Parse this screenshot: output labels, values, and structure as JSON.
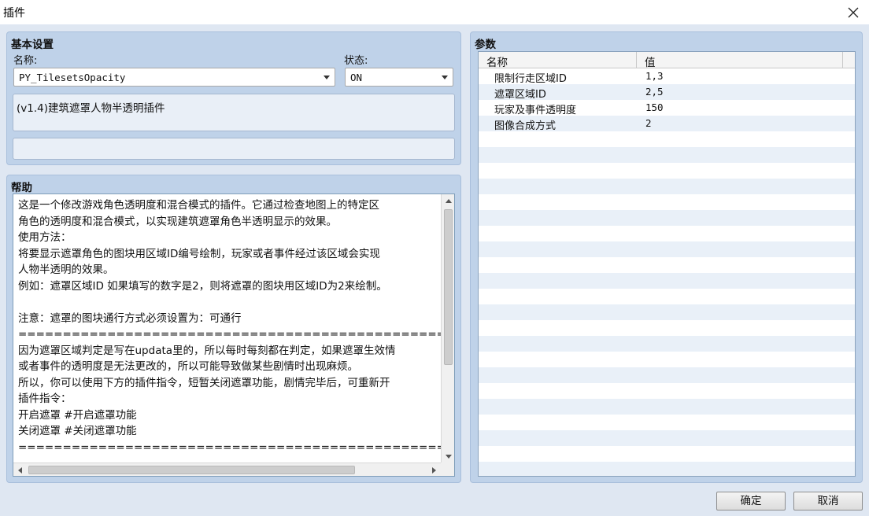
{
  "window": {
    "title": "插件"
  },
  "basic": {
    "title": "基本设置",
    "name_label": "名称:",
    "name_value": "PY_TilesetsOpacity",
    "status_label": "状态:",
    "status_value": "ON",
    "description": "(v1.4)建筑遮罩人物半透明插件",
    "author": ""
  },
  "help": {
    "title": "帮助",
    "lines": [
      "这是一个修改游戏角色透明度和混合模式的插件。它通过检查地图上的特定区",
      "角色的透明度和混合模式，以实现建筑遮罩角色半透明显示的效果。",
      "使用方法：",
      "将要显示遮罩角色的图块用区域ID编号绘制，玩家或者事件经过该区域会实现",
      "人物半透明的效果。",
      "例如：遮罩区域ID 如果填写的数字是2，则将遮罩的图块用区域ID为2来绘制。",
      "",
      "注意：遮罩的图块通行方式必须设置为：可通行",
      "==========================================================================",
      "因为遮罩区域判定是写在updata里的，所以每时每刻都在判定，如果遮罩生效情",
      "或者事件的透明度是无法更改的，所以可能导致做某些剧情时出现麻烦。",
      "所以，你可以使用下方的插件指令，短暂关闭遮罩功能，剧情完毕后，可重新开",
      "插件指令：",
      "开启遮罩  #开启遮罩功能",
      "关闭遮罩  #关闭遮罩功能",
      "=========================================================================="
    ]
  },
  "params": {
    "title": "参数",
    "col_name": "名称",
    "col_value": "值",
    "rows": [
      {
        "name": "限制行走区域ID",
        "value": "1,3"
      },
      {
        "name": "遮罩区域ID",
        "value": "2,5"
      },
      {
        "name": "玩家及事件透明度",
        "value": "150"
      },
      {
        "name": "图像合成方式",
        "value": "2"
      }
    ],
    "empty_rows": 22
  },
  "buttons": {
    "ok": "确定",
    "cancel": "取消"
  }
}
